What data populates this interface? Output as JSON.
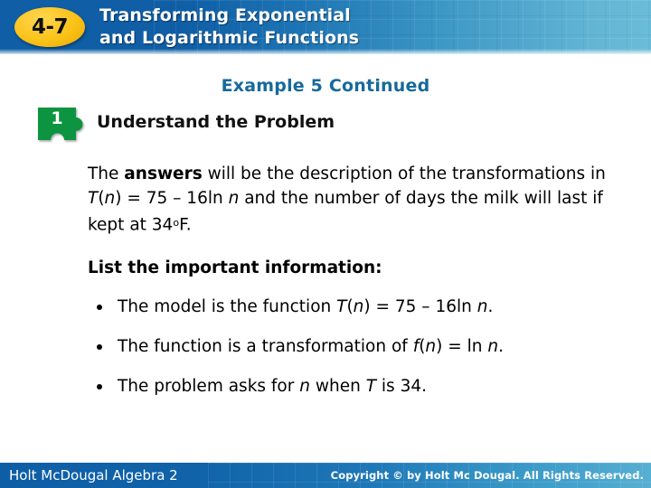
{
  "header": {
    "badge_label": "4-7",
    "title_line1": "Transforming Exponential",
    "title_line2": "and Logarithmic Functions",
    "bg_left_color": "#0f5ea6",
    "bg_right_color": "#6bbcd8",
    "badge_color": "#fbc218"
  },
  "example": {
    "heading": "Example 5 Continued",
    "heading_color": "#17699b"
  },
  "step": {
    "number": "1",
    "title": "Understand the Problem",
    "puzzle_color": "#0a9440"
  },
  "body": {
    "paragraph": {
      "seg1": "The ",
      "seg2_bold": "answers",
      "seg3": " will be the description of the transformations in ",
      "seg4_italic": "T",
      "seg5": "(",
      "seg6_italic": "n",
      "seg7": ") = 75 – 16ln ",
      "seg8_italic": "n",
      "seg9": " and the number of days the milk will last if kept at 34",
      "seg10_degree": "o",
      "seg11": "F."
    },
    "list_heading": "List the important information:",
    "bullets": [
      {
        "pre": "The model is the function ",
        "fn_italic": "T",
        "open": "(",
        "var_italic": "n",
        "close": ") = 75 – 16ln ",
        "var2_italic": "n",
        "post": "."
      },
      {
        "pre": "The function is a transformation of ",
        "fn_italic": "f",
        "open": "(",
        "var_italic": "n",
        "close": ") = ln ",
        "var2_italic": "n",
        "post": "."
      },
      {
        "pre": "The problem asks for ",
        "fn_italic": "n",
        "open": " when ",
        "var_italic": "T",
        "close": " is 34.",
        "var2_italic": "",
        "post": ""
      }
    ]
  },
  "footer": {
    "left_text": "Holt McDougal Algebra 2",
    "right_text": "Copyright © by Holt Mc Dougal. All Rights Reserved.",
    "bg_left_color": "#0e5ea6",
    "bg_right_color": "#57afd2"
  }
}
